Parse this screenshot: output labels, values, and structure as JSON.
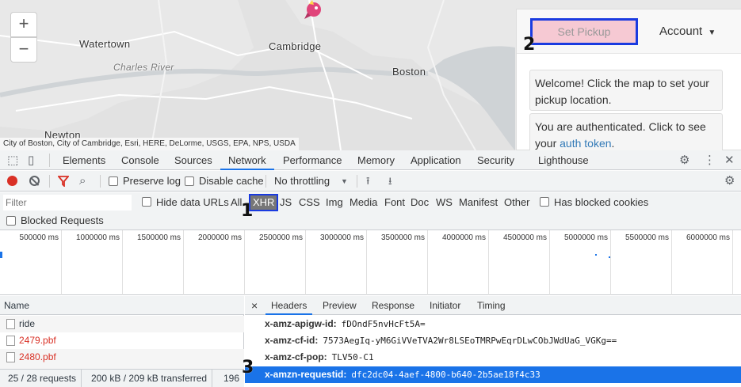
{
  "map": {
    "labels": [
      "Watertown",
      "Cambridge",
      "Charles River",
      "Boston",
      "Newton"
    ],
    "zoom_in": "+",
    "zoom_out": "−",
    "attribution": "City of Boston, City of Cambridge, Esri, HERE, DeLorme, USGS, EPA, NPS, USDA"
  },
  "panel": {
    "pickup_label": "Set Pickup",
    "account_label": "Account",
    "welcome_msg": "Welcome! Click the map to set your pickup location.",
    "auth_msg_prefix": "You are authenticated. Click to see your",
    "auth_link": "auth token",
    "auth_msg_suffix": "."
  },
  "annotations": [
    "1",
    "2",
    "3"
  ],
  "devtools": {
    "tabs": [
      "Elements",
      "Console",
      "Sources",
      "Network",
      "Performance",
      "Memory",
      "Application",
      "Security",
      "Lighthouse"
    ],
    "active_tab": "Network",
    "toolbar": {
      "preserve_log": "Preserve log",
      "disable_cache": "Disable cache",
      "throttling": "No throttling"
    },
    "filter": {
      "placeholder": "Filter",
      "hide_data_urls": "Hide data URLs",
      "types": [
        "All",
        "XHR",
        "JS",
        "CSS",
        "Img",
        "Media",
        "Font",
        "Doc",
        "WS",
        "Manifest",
        "Other"
      ],
      "active_type": "XHR",
      "has_blocked_cookies": "Has blocked cookies",
      "blocked_requests": "Blocked Requests"
    },
    "timeline_ticks": [
      "500000 ms",
      "1000000 ms",
      "1500000 ms",
      "2000000 ms",
      "2500000 ms",
      "3000000 ms",
      "3500000 ms",
      "4000000 ms",
      "4500000 ms",
      "5000000 ms",
      "5500000 ms",
      "6000000 ms"
    ],
    "requests": {
      "column": "Name",
      "rows": [
        {
          "name": "ride",
          "error": false
        },
        {
          "name": "2479.pbf",
          "error": true
        },
        {
          "name": "2480.pbf",
          "error": true
        }
      ],
      "status": {
        "count": "25 / 28 requests",
        "transferred": "200 kB / 209 kB transferred",
        "extra": "196"
      }
    },
    "detail": {
      "close": "×",
      "tabs": [
        "Headers",
        "Preview",
        "Response",
        "Initiator",
        "Timing"
      ],
      "active_tab": "Headers",
      "headers": [
        {
          "key": "x-amz-apigw-id:",
          "value": "fDOndF5nvHcFt5A="
        },
        {
          "key": "x-amz-cf-id:",
          "value": "7573AegIq-yM6GiVVeTVA2Wr8LSEoTMRPwEqrDLwCObJWdUaG_VGKg=="
        },
        {
          "key": "x-amz-cf-pop:",
          "value": "TLV50-C1"
        },
        {
          "key": "x-amzn-requestid:",
          "value": "dfc2dc04-4aef-4800-b640-2b5ae18f4c33"
        }
      ]
    }
  }
}
